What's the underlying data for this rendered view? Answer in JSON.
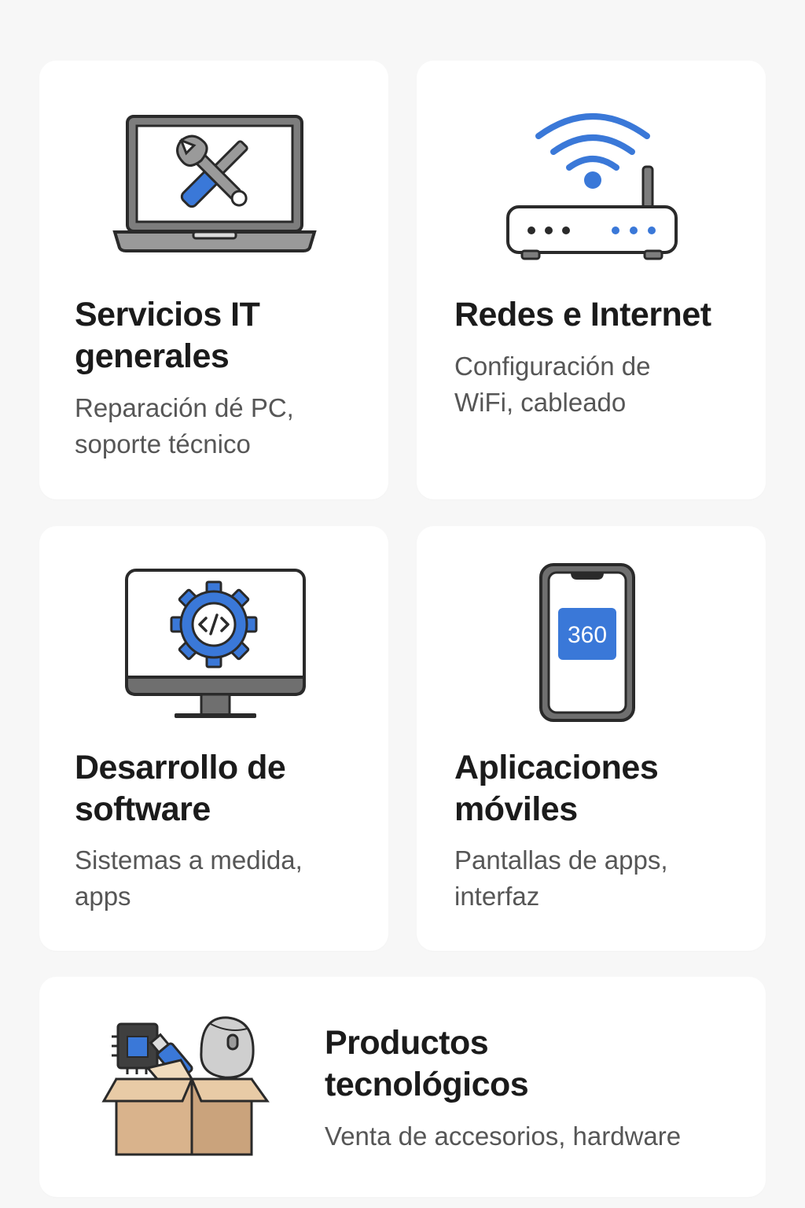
{
  "services": [
    {
      "id": "it",
      "title_line1": "Servicios IT",
      "title_line2": "generales",
      "desc_line1": "Reparación dé PC,",
      "desc_line2": "soporte técnico",
      "icon": "laptop-tools-icon"
    },
    {
      "id": "net",
      "title_line1": "Redes e Internet",
      "title_line2": "",
      "desc_line1": "Configuración de",
      "desc_line2": "WiFi, cableado",
      "icon": "wifi-router-icon"
    },
    {
      "id": "dev",
      "title_line1": "Desarrollo de",
      "title_line2": "software",
      "desc_line1": "Sistemas a medida,",
      "desc_line2": "apps",
      "icon": "monitor-gear-code-icon"
    },
    {
      "id": "mob",
      "title_line1": "Aplicaciones",
      "title_line2": "móviles",
      "desc_line1": "Pantallas de apps,",
      "desc_line2": "interfaz",
      "icon": "smartphone-icon",
      "badge": "360"
    },
    {
      "id": "prod",
      "title_line1": "Productos",
      "title_line2": "tecnológicos",
      "desc_line1": "Venta de accesorios, hardware",
      "desc_line2": "",
      "icon": "box-hardware-icon"
    }
  ],
  "colors": {
    "accent_blue": "#3a78d8",
    "outline": "#2a2a2a",
    "gray": "#8e8e8e",
    "background": "#f7f7f7",
    "card": "#ffffff",
    "cardboard": "#d9b38c"
  }
}
